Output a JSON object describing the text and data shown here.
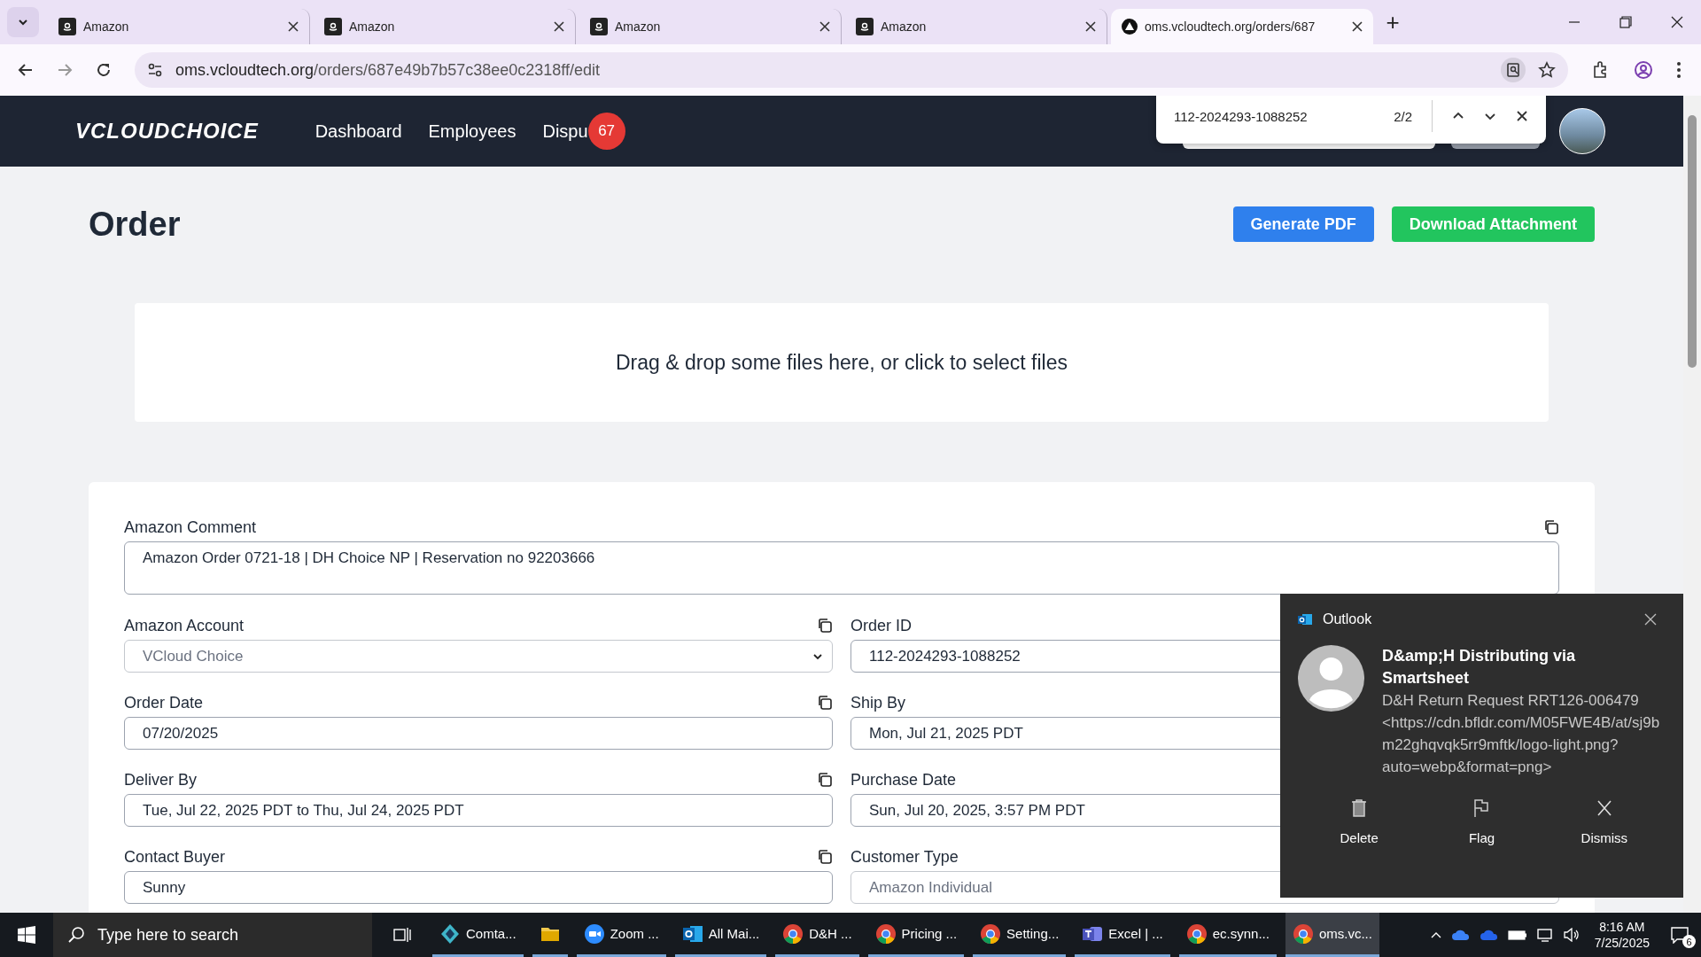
{
  "browser": {
    "tabs": [
      {
        "title": "Amazon",
        "kind": "amazon",
        "selected": false
      },
      {
        "title": "Amazon",
        "kind": "amazon",
        "selected": false
      },
      {
        "title": "Amazon",
        "kind": "amazon",
        "selected": false
      },
      {
        "title": "Amazon",
        "kind": "amazon",
        "selected": false
      },
      {
        "title": "oms.vcloudtech.org/orders/687",
        "kind": "site",
        "selected": true
      }
    ],
    "new_tab": "+",
    "address": {
      "domain": "oms.vcloudtech.org",
      "path": "/orders/687e49b7b57c38ee0c2318ff/edit"
    }
  },
  "find_bar": {
    "query": "112-2024293-1088252",
    "count": "2/2"
  },
  "nav": {
    "logo": "VCLOUDCHOICE",
    "links": [
      "Dashboard",
      "Employees",
      "Dispu"
    ],
    "badge": "67"
  },
  "page": {
    "title": "Order",
    "buttons": [
      {
        "label": "Generate PDF",
        "kind": "primary"
      },
      {
        "label": "Download Attachment",
        "kind": "success"
      }
    ],
    "dropzone": "Drag & drop some files here, or click to select files"
  },
  "form": {
    "comment": {
      "label": "Amazon Comment",
      "value": "Amazon Order 0721-18 | DH Choice NP | Reservation no 92203666"
    },
    "fields": [
      {
        "label": "Amazon Account",
        "value": "VCloud Choice",
        "kind": "select",
        "disabled": true
      },
      {
        "label": "Order ID",
        "value": "112-2024293-1088252",
        "kind": "text",
        "disabled": false
      },
      {
        "label": "Order Date",
        "value": "07/20/2025",
        "kind": "text",
        "disabled": false
      },
      {
        "label": "Ship By",
        "value": "Mon, Jul 21, 2025 PDT",
        "kind": "text",
        "disabled": false
      },
      {
        "label": "Deliver By",
        "value": "Tue, Jul 22, 2025 PDT to Thu, Jul 24, 2025 PDT",
        "kind": "text",
        "disabled": false
      },
      {
        "label": "Purchase Date",
        "value": "Sun, Jul 20, 2025, 3:57 PM PDT",
        "kind": "text",
        "disabled": false
      },
      {
        "label": "Contact Buyer",
        "value": "Sunny",
        "kind": "text",
        "disabled": false
      },
      {
        "label": "Customer Type",
        "value": "Amazon Individual",
        "kind": "text",
        "disabled": true
      }
    ]
  },
  "notification": {
    "app": "Outlook",
    "sender": "D&amp;H Distributing via Smartsheet",
    "body": "D&H Return Request RRT126-006479 <https://cdn.bfldr.com/M05FWE4B/at/sj9bm22ghqvqk5rr9mftk/logo-light.png?auto=webp&format=png>",
    "actions": [
      {
        "label": "Delete",
        "kind": "delete"
      },
      {
        "label": "Flag",
        "kind": "flag"
      },
      {
        "label": "Dismiss",
        "kind": "dismiss"
      }
    ]
  },
  "taskbar": {
    "search_placeholder": "Type here to search",
    "apps": [
      {
        "label": "Comta...",
        "kind": "comtax",
        "selected": false
      },
      {
        "kind": "folder",
        "selected": false
      },
      {
        "label": "Zoom ...",
        "kind": "zoom",
        "selected": false
      },
      {
        "label": "All Mai...",
        "kind": "outlook",
        "selected": false
      },
      {
        "label": "D&H ...",
        "kind": "chrome",
        "selected": false
      },
      {
        "label": "Pricing ...",
        "kind": "chrome",
        "selected": false
      },
      {
        "label": "Setting...",
        "kind": "chrome",
        "selected": false
      },
      {
        "label": "Excel | ...",
        "kind": "teams",
        "selected": false
      },
      {
        "label": "ec.synn...",
        "kind": "chrome",
        "selected": false
      },
      {
        "label": "oms.vc...",
        "kind": "chrome",
        "selected": true
      }
    ],
    "time": "8:16 AM",
    "date": "7/25/2025",
    "notifications": "6"
  }
}
